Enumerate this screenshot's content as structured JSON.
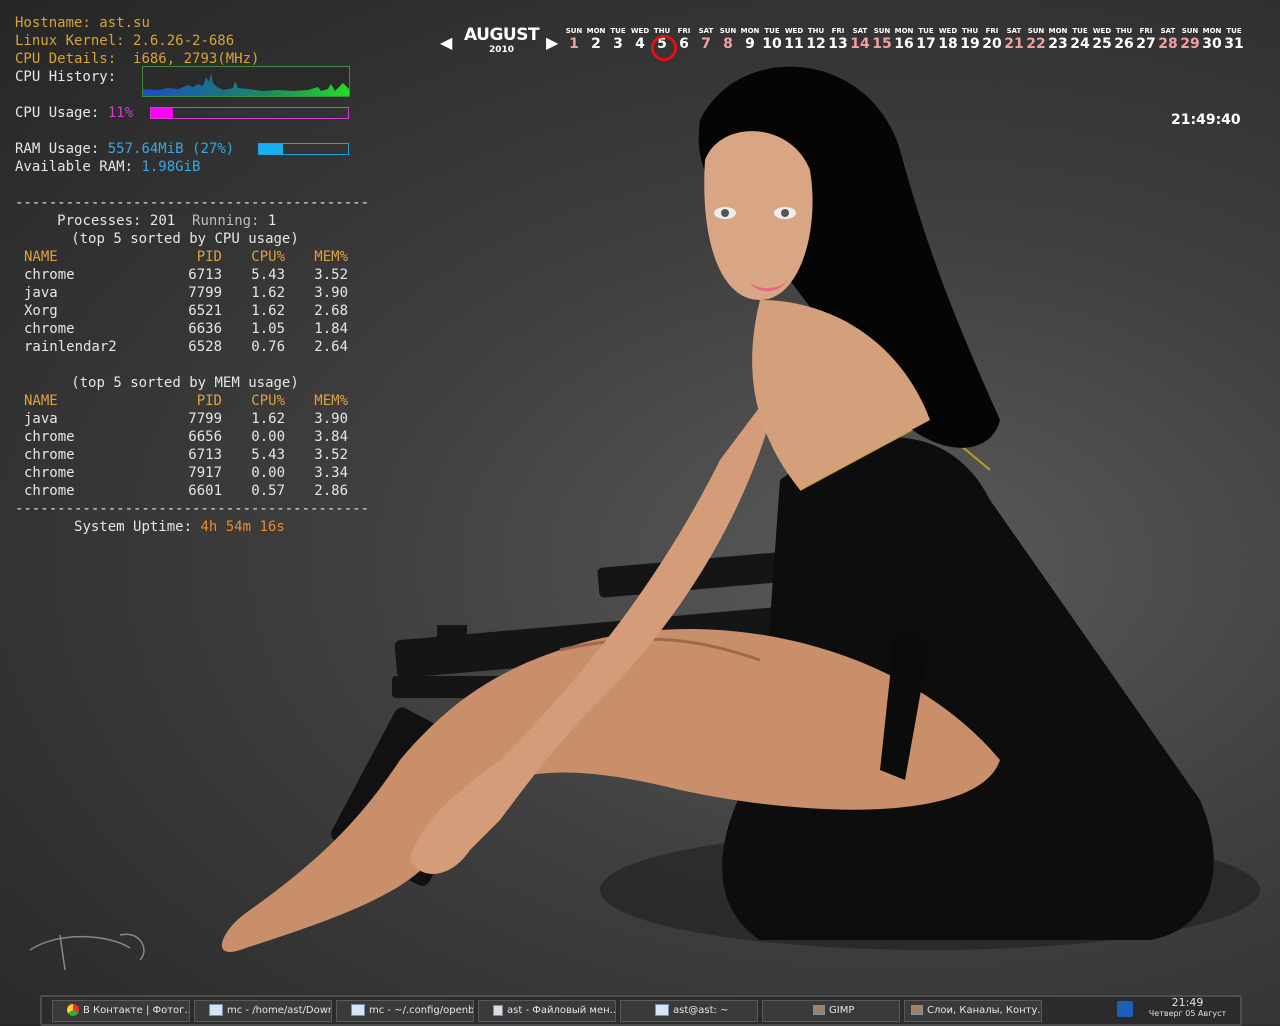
{
  "conky": {
    "hostname_label": "Hostname:",
    "hostname": "ast.su",
    "kernel_label": "Linux Kernel:",
    "kernel": "2.6.26-2-686",
    "cpu_details_label": "CPU Details:",
    "cpu_details": "i686, 2793(MHz)",
    "cpu_history_label": "CPU History:",
    "cpu_usage_label": "CPU Usage:",
    "cpu_usage": "11%",
    "cpu_usage_fraction": 0.11,
    "ram_usage_label": "RAM Usage:",
    "ram_usage": "557.64MiB (27%)",
    "ram_usage_fraction": 0.27,
    "available_ram_label": "Available RAM:",
    "available_ram": "1.98GiB",
    "separator": "------------------------------------------",
    "processes_label": "Processes:",
    "processes": "201",
    "running_label": "Running:",
    "running": "1",
    "top_cpu_title": "(top 5 sorted by CPU usage)",
    "top_mem_title": "(top 5 sorted by MEM usage)",
    "columns": [
      "NAME",
      "PID",
      "CPU%",
      "MEM%"
    ],
    "top_cpu": [
      {
        "name": "chrome",
        "pid": "6713",
        "cpu": "5.43",
        "mem": "3.52"
      },
      {
        "name": "java",
        "pid": "7799",
        "cpu": "1.62",
        "mem": "3.90"
      },
      {
        "name": "Xorg",
        "pid": "6521",
        "cpu": "1.62",
        "mem": "2.68"
      },
      {
        "name": "chrome",
        "pid": "6636",
        "cpu": "1.05",
        "mem": "1.84"
      },
      {
        "name": "rainlendar2",
        "pid": "6528",
        "cpu": "0.76",
        "mem": "2.64"
      }
    ],
    "top_mem": [
      {
        "name": "java",
        "pid": "7799",
        "cpu": "1.62",
        "mem": "3.90"
      },
      {
        "name": "chrome",
        "pid": "6656",
        "cpu": "0.00",
        "mem": "3.84"
      },
      {
        "name": "chrome",
        "pid": "6713",
        "cpu": "5.43",
        "mem": "3.52"
      },
      {
        "name": "chrome",
        "pid": "7917",
        "cpu": "0.00",
        "mem": "3.34"
      },
      {
        "name": "chrome",
        "pid": "6601",
        "cpu": "0.57",
        "mem": "2.86"
      }
    ],
    "uptime_label": "System Uptime:",
    "uptime": "4h 54m 16s"
  },
  "calendar": {
    "prev_icon": "triangle-left-icon",
    "next_icon": "triangle-right-icon",
    "month": "AUGUST",
    "year": "2010",
    "today": 5,
    "days": [
      {
        "dow": "SUN",
        "n": "1",
        "weekend": true
      },
      {
        "dow": "MON",
        "n": "2"
      },
      {
        "dow": "TUE",
        "n": "3"
      },
      {
        "dow": "WED",
        "n": "4"
      },
      {
        "dow": "THU",
        "n": "5",
        "today": true
      },
      {
        "dow": "FRI",
        "n": "6"
      },
      {
        "dow": "SAT",
        "n": "7",
        "weekend": true
      },
      {
        "dow": "SUN",
        "n": "8",
        "weekend": true
      },
      {
        "dow": "MON",
        "n": "9"
      },
      {
        "dow": "TUE",
        "n": "10"
      },
      {
        "dow": "WED",
        "n": "11"
      },
      {
        "dow": "THU",
        "n": "12"
      },
      {
        "dow": "FRI",
        "n": "13"
      },
      {
        "dow": "SAT",
        "n": "14",
        "weekend": true
      },
      {
        "dow": "SUN",
        "n": "15",
        "weekend": true
      },
      {
        "dow": "MON",
        "n": "16"
      },
      {
        "dow": "TUE",
        "n": "17"
      },
      {
        "dow": "WED",
        "n": "18"
      },
      {
        "dow": "THU",
        "n": "19"
      },
      {
        "dow": "FRI",
        "n": "20"
      },
      {
        "dow": "SAT",
        "n": "21",
        "weekend": true
      },
      {
        "dow": "SUN",
        "n": "22",
        "weekend": true
      },
      {
        "dow": "MON",
        "n": "23"
      },
      {
        "dow": "TUE",
        "n": "24"
      },
      {
        "dow": "WED",
        "n": "25"
      },
      {
        "dow": "THU",
        "n": "26"
      },
      {
        "dow": "FRI",
        "n": "27"
      },
      {
        "dow": "SAT",
        "n": "28",
        "weekend": true
      },
      {
        "dow": "SUN",
        "n": "29",
        "weekend": true
      },
      {
        "dow": "MON",
        "n": "30"
      },
      {
        "dow": "TUE",
        "n": "31"
      }
    ]
  },
  "clock": "21:49:40",
  "taskbar": {
    "tasks": [
      {
        "label": "В Контакте | Фотог...",
        "icon": "chrome-icon"
      },
      {
        "label": "mc - /home/ast/Down...",
        "icon": "terminal-icon"
      },
      {
        "label": "mc - ~/.config/openb...",
        "icon": "terminal-icon"
      },
      {
        "label": "ast - Файловый мен...",
        "icon": "file-manager-icon"
      },
      {
        "label": "ast@ast: ~",
        "icon": "terminal-icon"
      },
      {
        "label": "GIMP",
        "icon": "gimp-icon"
      },
      {
        "label": "Слои, Каналы, Конту...",
        "icon": "gimp-icon"
      }
    ],
    "tray_icon": "network-icon",
    "time": "21:49",
    "date": "Четверг 05 Август"
  },
  "colors": {
    "label": "#d6a339",
    "cpu": "#ff00ff",
    "ram": "#18b0f0",
    "uptime": "#f08a28",
    "graph_border": "#3f8a3f"
  }
}
